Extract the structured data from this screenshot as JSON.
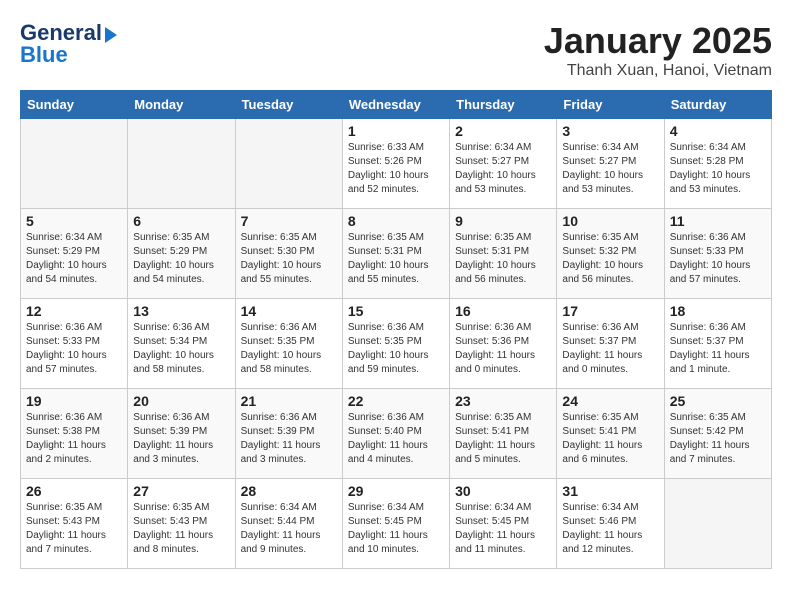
{
  "header": {
    "logo_general": "General",
    "logo_blue": "Blue",
    "month_title": "January 2025",
    "location": "Thanh Xuan, Hanoi, Vietnam"
  },
  "days_of_week": [
    "Sunday",
    "Monday",
    "Tuesday",
    "Wednesday",
    "Thursday",
    "Friday",
    "Saturday"
  ],
  "weeks": [
    [
      {
        "day": "",
        "sunrise": "",
        "sunset": "",
        "daylight": "",
        "empty": true
      },
      {
        "day": "",
        "sunrise": "",
        "sunset": "",
        "daylight": "",
        "empty": true
      },
      {
        "day": "",
        "sunrise": "",
        "sunset": "",
        "daylight": "",
        "empty": true
      },
      {
        "day": "1",
        "sunrise": "Sunrise: 6:33 AM",
        "sunset": "Sunset: 5:26 PM",
        "daylight": "Daylight: 10 hours and 52 minutes."
      },
      {
        "day": "2",
        "sunrise": "Sunrise: 6:34 AM",
        "sunset": "Sunset: 5:27 PM",
        "daylight": "Daylight: 10 hours and 53 minutes."
      },
      {
        "day": "3",
        "sunrise": "Sunrise: 6:34 AM",
        "sunset": "Sunset: 5:27 PM",
        "daylight": "Daylight: 10 hours and 53 minutes."
      },
      {
        "day": "4",
        "sunrise": "Sunrise: 6:34 AM",
        "sunset": "Sunset: 5:28 PM",
        "daylight": "Daylight: 10 hours and 53 minutes."
      }
    ],
    [
      {
        "day": "5",
        "sunrise": "Sunrise: 6:34 AM",
        "sunset": "Sunset: 5:29 PM",
        "daylight": "Daylight: 10 hours and 54 minutes."
      },
      {
        "day": "6",
        "sunrise": "Sunrise: 6:35 AM",
        "sunset": "Sunset: 5:29 PM",
        "daylight": "Daylight: 10 hours and 54 minutes."
      },
      {
        "day": "7",
        "sunrise": "Sunrise: 6:35 AM",
        "sunset": "Sunset: 5:30 PM",
        "daylight": "Daylight: 10 hours and 55 minutes."
      },
      {
        "day": "8",
        "sunrise": "Sunrise: 6:35 AM",
        "sunset": "Sunset: 5:31 PM",
        "daylight": "Daylight: 10 hours and 55 minutes."
      },
      {
        "day": "9",
        "sunrise": "Sunrise: 6:35 AM",
        "sunset": "Sunset: 5:31 PM",
        "daylight": "Daylight: 10 hours and 56 minutes."
      },
      {
        "day": "10",
        "sunrise": "Sunrise: 6:35 AM",
        "sunset": "Sunset: 5:32 PM",
        "daylight": "Daylight: 10 hours and 56 minutes."
      },
      {
        "day": "11",
        "sunrise": "Sunrise: 6:36 AM",
        "sunset": "Sunset: 5:33 PM",
        "daylight": "Daylight: 10 hours and 57 minutes."
      }
    ],
    [
      {
        "day": "12",
        "sunrise": "Sunrise: 6:36 AM",
        "sunset": "Sunset: 5:33 PM",
        "daylight": "Daylight: 10 hours and 57 minutes."
      },
      {
        "day": "13",
        "sunrise": "Sunrise: 6:36 AM",
        "sunset": "Sunset: 5:34 PM",
        "daylight": "Daylight: 10 hours and 58 minutes."
      },
      {
        "day": "14",
        "sunrise": "Sunrise: 6:36 AM",
        "sunset": "Sunset: 5:35 PM",
        "daylight": "Daylight: 10 hours and 58 minutes."
      },
      {
        "day": "15",
        "sunrise": "Sunrise: 6:36 AM",
        "sunset": "Sunset: 5:35 PM",
        "daylight": "Daylight: 10 hours and 59 minutes."
      },
      {
        "day": "16",
        "sunrise": "Sunrise: 6:36 AM",
        "sunset": "Sunset: 5:36 PM",
        "daylight": "Daylight: 11 hours and 0 minutes."
      },
      {
        "day": "17",
        "sunrise": "Sunrise: 6:36 AM",
        "sunset": "Sunset: 5:37 PM",
        "daylight": "Daylight: 11 hours and 0 minutes."
      },
      {
        "day": "18",
        "sunrise": "Sunrise: 6:36 AM",
        "sunset": "Sunset: 5:37 PM",
        "daylight": "Daylight: 11 hours and 1 minute."
      }
    ],
    [
      {
        "day": "19",
        "sunrise": "Sunrise: 6:36 AM",
        "sunset": "Sunset: 5:38 PM",
        "daylight": "Daylight: 11 hours and 2 minutes."
      },
      {
        "day": "20",
        "sunrise": "Sunrise: 6:36 AM",
        "sunset": "Sunset: 5:39 PM",
        "daylight": "Daylight: 11 hours and 3 minutes."
      },
      {
        "day": "21",
        "sunrise": "Sunrise: 6:36 AM",
        "sunset": "Sunset: 5:39 PM",
        "daylight": "Daylight: 11 hours and 3 minutes."
      },
      {
        "day": "22",
        "sunrise": "Sunrise: 6:36 AM",
        "sunset": "Sunset: 5:40 PM",
        "daylight": "Daylight: 11 hours and 4 minutes."
      },
      {
        "day": "23",
        "sunrise": "Sunrise: 6:35 AM",
        "sunset": "Sunset: 5:41 PM",
        "daylight": "Daylight: 11 hours and 5 minutes."
      },
      {
        "day": "24",
        "sunrise": "Sunrise: 6:35 AM",
        "sunset": "Sunset: 5:41 PM",
        "daylight": "Daylight: 11 hours and 6 minutes."
      },
      {
        "day": "25",
        "sunrise": "Sunrise: 6:35 AM",
        "sunset": "Sunset: 5:42 PM",
        "daylight": "Daylight: 11 hours and 7 minutes."
      }
    ],
    [
      {
        "day": "26",
        "sunrise": "Sunrise: 6:35 AM",
        "sunset": "Sunset: 5:43 PM",
        "daylight": "Daylight: 11 hours and 7 minutes."
      },
      {
        "day": "27",
        "sunrise": "Sunrise: 6:35 AM",
        "sunset": "Sunset: 5:43 PM",
        "daylight": "Daylight: 11 hours and 8 minutes."
      },
      {
        "day": "28",
        "sunrise": "Sunrise: 6:34 AM",
        "sunset": "Sunset: 5:44 PM",
        "daylight": "Daylight: 11 hours and 9 minutes."
      },
      {
        "day": "29",
        "sunrise": "Sunrise: 6:34 AM",
        "sunset": "Sunset: 5:45 PM",
        "daylight": "Daylight: 11 hours and 10 minutes."
      },
      {
        "day": "30",
        "sunrise": "Sunrise: 6:34 AM",
        "sunset": "Sunset: 5:45 PM",
        "daylight": "Daylight: 11 hours and 11 minutes."
      },
      {
        "day": "31",
        "sunrise": "Sunrise: 6:34 AM",
        "sunset": "Sunset: 5:46 PM",
        "daylight": "Daylight: 11 hours and 12 minutes."
      },
      {
        "day": "",
        "sunrise": "",
        "sunset": "",
        "daylight": "",
        "empty": true
      }
    ]
  ]
}
